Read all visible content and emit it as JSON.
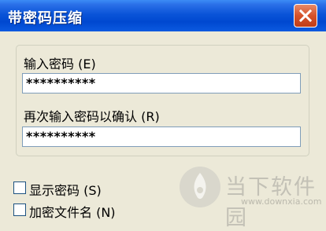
{
  "window": {
    "title": "带密码压缩"
  },
  "password": {
    "label": "输入密码 (E)",
    "value": "**********"
  },
  "confirm": {
    "label": "再次输入密码以确认 (R)",
    "value": "**********"
  },
  "options": [
    {
      "label": "显示密码 (S)",
      "checked": false
    },
    {
      "label": "加密文件名 (N)",
      "checked": false
    }
  ],
  "watermark": {
    "text": "当下软件园",
    "url": "www.downxia.com"
  },
  "icons": {
    "close": "close-icon",
    "logo": "downxia-logo-icon"
  },
  "colors": {
    "titlebar": "#0a54d8",
    "close": "#d6522a",
    "dialog": "#ece9d8"
  }
}
